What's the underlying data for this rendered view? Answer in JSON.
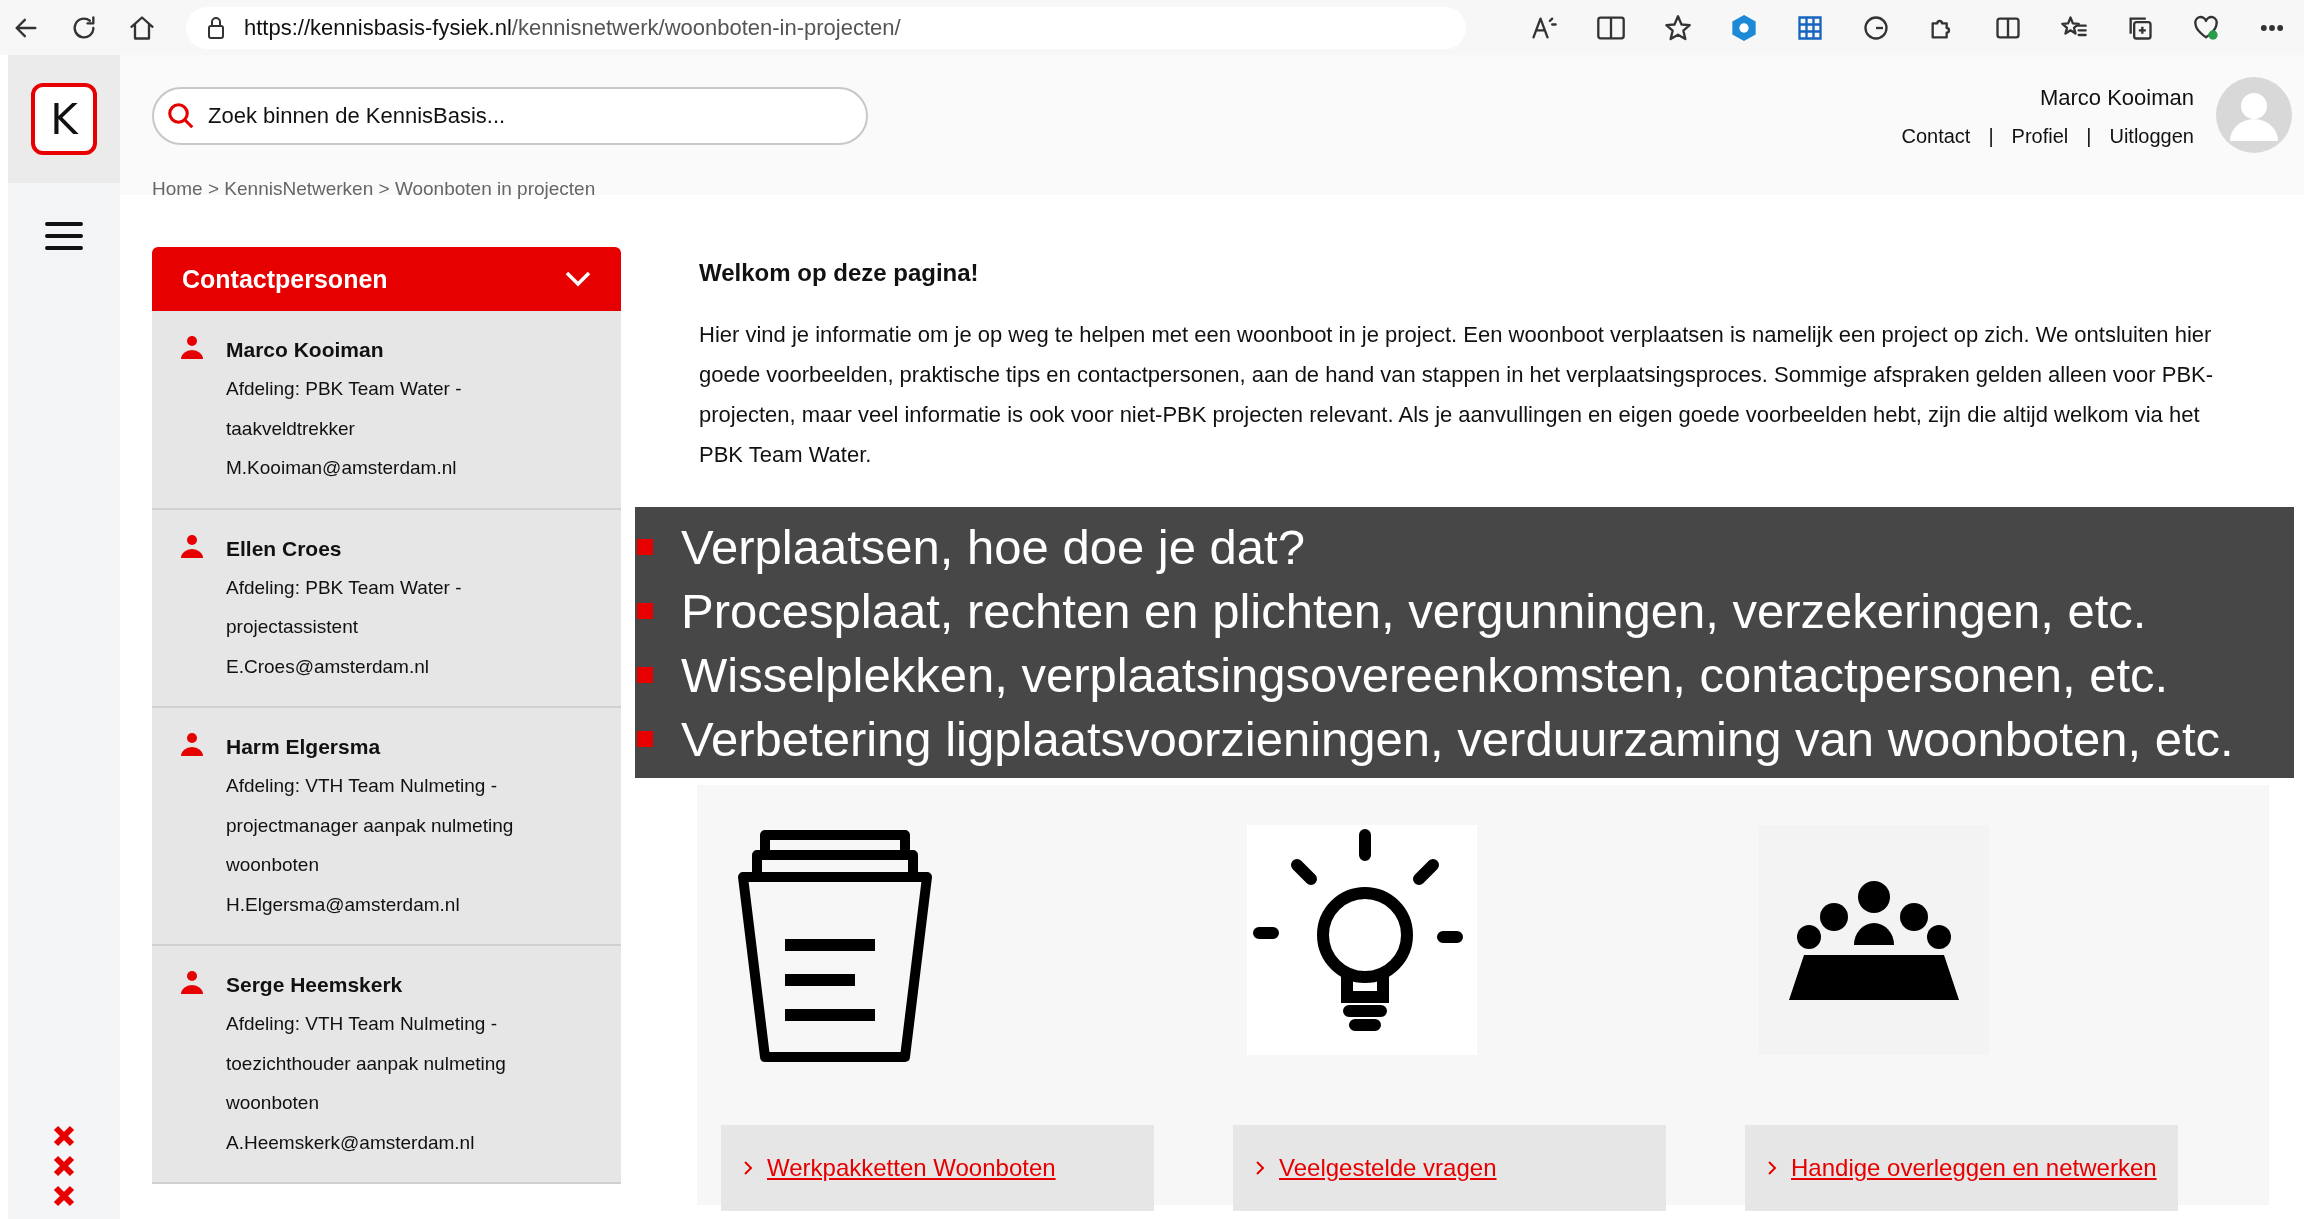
{
  "browser": {
    "url_host": "https://kennisbasis-fysiek.nl",
    "url_path": "/kennisnetwerk/woonboten-in-projecten/"
  },
  "header": {
    "logo_letter": "K",
    "search": {
      "placeholder": "Zoek binnen de KennisBasis..."
    },
    "user_name": "Marco Kooiman",
    "links": [
      "Contact",
      "Profiel",
      "Uitloggen"
    ],
    "separators": [
      "|",
      "|"
    ]
  },
  "breadcrumb": "Home > KennisNetwerken > Woonboten in projecten",
  "contacts": {
    "title": "Contactpersonen",
    "expanded": true,
    "people": [
      {
        "name": "Marco Kooiman",
        "department": "Afdeling: PBK Team Water - taakveldtrekker",
        "email": "M.Kooiman@amsterdam.nl"
      },
      {
        "name": "Ellen Croes",
        "department": "Afdeling: PBK Team Water - projectassistent",
        "email": "E.Croes@amsterdam.nl"
      },
      {
        "name": "Harm Elgersma",
        "department": "Afdeling: VTH Team Nulmeting - projectmanager aanpak nulmeting woonboten",
        "email": "H.Elgersma@amsterdam.nl"
      },
      {
        "name": "Serge Heemskerk",
        "department": "Afdeling: VTH Team Nulmeting - toezichthouder aanpak nulmeting woonboten",
        "email": "A.Heemskerk@amsterdam.nl"
      }
    ]
  },
  "content": {
    "heading": "Welkom op deze pagina!",
    "intro": "Hier vind je informatie om je op weg te helpen met een woonboot in je project. Een woonboot verplaatsen is namelijk een project op zich. We ontsluiten hier goede voorbeelden, praktische tips en contactpersonen, aan de hand van stappen in het verplaatsingsproces. Sommige afspraken gelden alleen voor PBK-projecten, maar veel informatie is ook voor niet-PBK projecten relevant. Als je aanvullingen en eigen goede voorbeelden hebt, zijn die altijd welkom via het PBK Team Water."
  },
  "overlay": {
    "bullets": [
      "Verplaatsen, hoe doe je dat?",
      "Procesplaat, rechten en plichten, vergunningen, verzekeringen, etc.",
      "Wisselplekken, verplaatsingsovereenkomsten, contactpersonen, etc.",
      "Verbetering ligplaatsvoorzieningen, verduurzaming van woonboten, etc."
    ]
  },
  "cards": [
    {
      "kind": "document",
      "link": "Werkpakketten Woonboten"
    },
    {
      "kind": "lightbulb",
      "link": "Veelgestelde vragen"
    },
    {
      "kind": "meeting",
      "link": "Handige overleggen en netwerken"
    }
  ]
}
